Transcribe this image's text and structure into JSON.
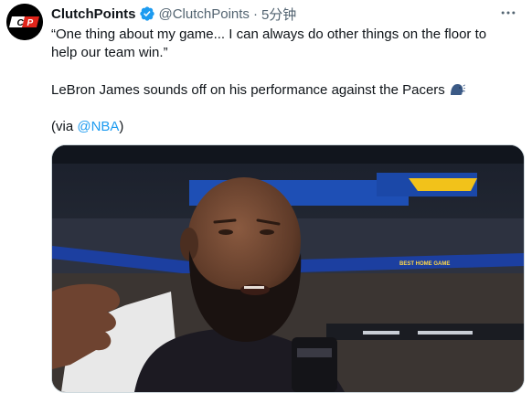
{
  "tweet": {
    "author_name": "ClutchPoints",
    "author_handle": "@ClutchPoints",
    "separator": "·",
    "timestamp": "5分钟",
    "avatar_text": "CP",
    "verified": true,
    "text_line1": "“One thing about my game... I can always do other things on the floor to",
    "text_line2": "help our team win.”",
    "text_line3": "LeBron James sounds off on his performance against the Pacers",
    "via_open": "(via ",
    "via_mention": "@NBA",
    "via_close": ")"
  },
  "media": {
    "description": "Video still: player interview on court",
    "banner_left": "",
    "banner_right": "BEST HOME GAME"
  },
  "icons": {
    "more": "more-horizontal-icon",
    "verified": "verified-badge-icon",
    "emoji": "speaking-head-emoji-icon"
  },
  "colors": {
    "accent": "#1d9bf0",
    "text_primary": "#0f1419",
    "text_secondary": "#536471",
    "avatar_brand": "#e1251b"
  }
}
